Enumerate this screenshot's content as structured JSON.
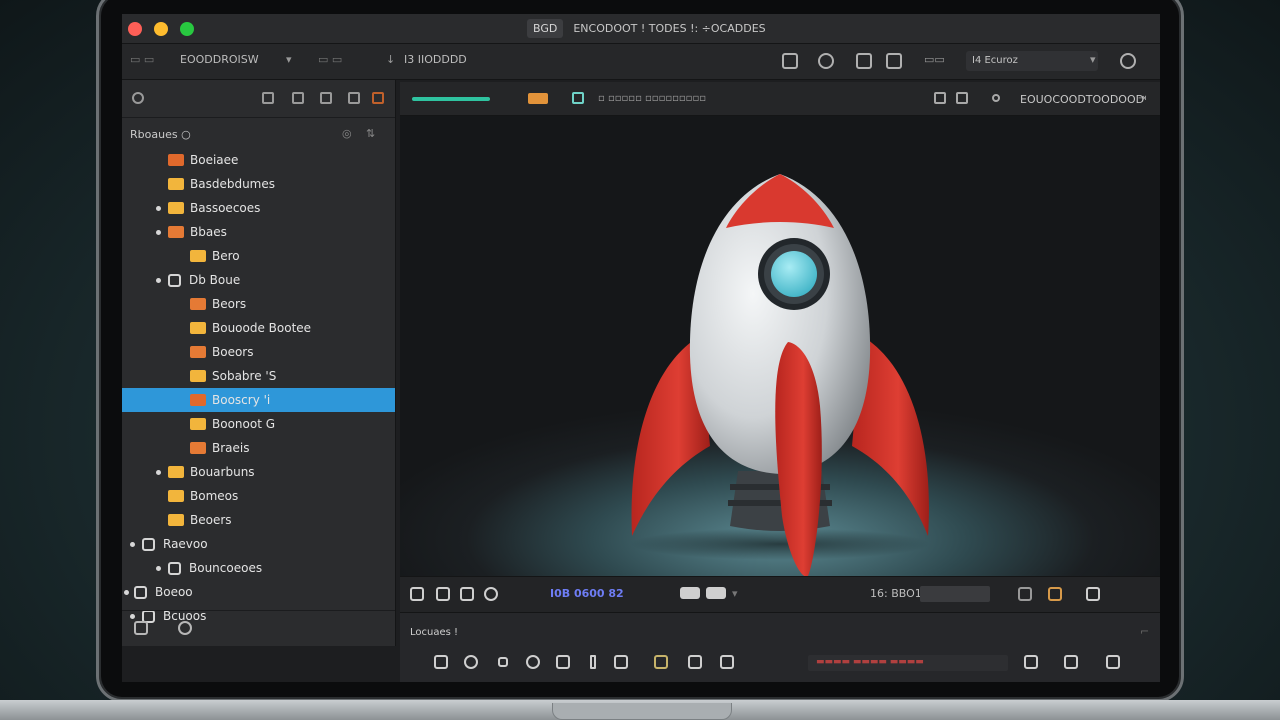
{
  "window": {
    "title_chip": "BGD",
    "title_text": "ENCODOOT !  TODES  !:  ÷OCADDES"
  },
  "toolbar": {
    "project_label": "EOODDROISW",
    "mode_label": "I3  IIODDDD",
    "search_value": "I4  Ecuroz"
  },
  "editor_header": {
    "mid_label": "▫  ▫▫▫▫▫  ▫▫▫▫▫▫▫▫▫",
    "right_label": "EOUOCOODTOODOOD"
  },
  "sidebar": {
    "section_label": "Rboaues  ○",
    "items": [
      {
        "label": "Boeiaee",
        "type": "folder",
        "color": "#e0692c"
      },
      {
        "label": "Basdebdumes",
        "type": "folder",
        "color": "#f2b53c"
      },
      {
        "label": "Bassoecoes",
        "type": "folder",
        "color": "#f2b53c"
      },
      {
        "label": "Bbaes",
        "type": "folder",
        "color": "#e57a35"
      },
      {
        "label": "Bero",
        "type": "folder",
        "color": "#f2b53c"
      },
      {
        "label": "Db Boue",
        "type": "gear",
        "color": "#d5d5d5"
      },
      {
        "label": "Beors",
        "type": "folder",
        "color": "#e57a35"
      },
      {
        "label": "Bouoode Bootee",
        "type": "folder",
        "color": "#f2b53c"
      },
      {
        "label": "Boeors",
        "type": "folder",
        "color": "#e57a35"
      },
      {
        "label": "Sobabre  'S",
        "type": "folder",
        "color": "#f2b53c"
      },
      {
        "label": "Booscry  'i",
        "type": "folder",
        "color": "#e0692c"
      },
      {
        "label": "Boonoot  G",
        "type": "folder",
        "color": "#f2b53c"
      },
      {
        "label": "Braeis",
        "type": "folder",
        "color": "#e57a35"
      },
      {
        "label": "Bouarbuns",
        "type": "folder",
        "color": "#f2b53c"
      },
      {
        "label": "Bomeos",
        "type": "folder",
        "color": "#f2b53c"
      },
      {
        "label": "Beoers",
        "type": "folder",
        "color": "#f2b53c"
      },
      {
        "label": "Raevoo",
        "type": "gear",
        "color": "#d5d5d5"
      },
      {
        "label": "Bouncoeoes",
        "type": "gear",
        "color": "#d5d5d5"
      },
      {
        "label": "Boeoo",
        "type": "gear",
        "color": "#d5d5d5"
      },
      {
        "label": "Bcuoos",
        "type": "gear",
        "color": "#d5d5d5"
      }
    ]
  },
  "playbar": {
    "timecode": "I0B  0600 82",
    "scrub_label": "16:  BBO1"
  },
  "timeline": {
    "label": "Locuaes  !"
  },
  "colors": {
    "selection": "#2e97d9",
    "rocket_red": "#d9392f",
    "rocket_body": "#e6e9ec",
    "window_cyan": "#6ed2e2"
  }
}
